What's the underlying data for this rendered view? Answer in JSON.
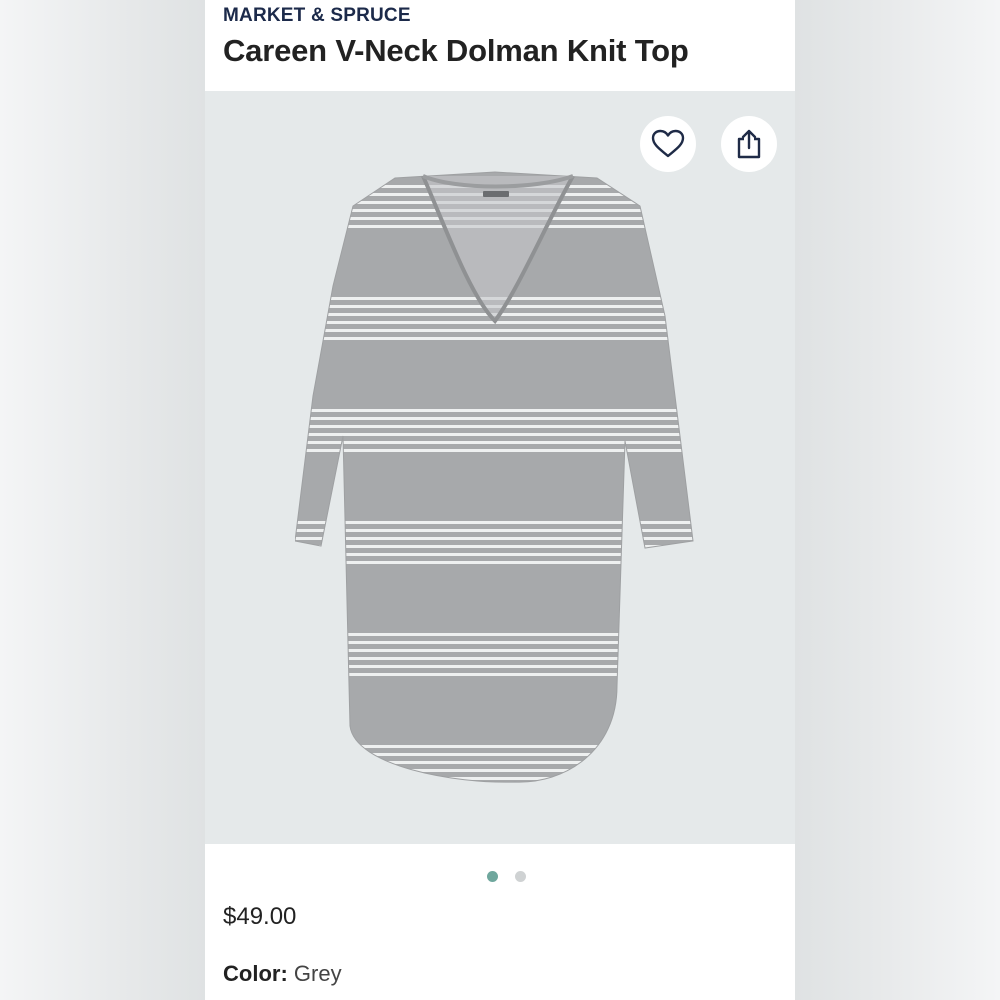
{
  "product": {
    "brand": "MARKET & SPRUCE",
    "title": "Careen V-Neck Dolman Knit Top",
    "price": "$49.00",
    "color_label": "Color:",
    "color_value": "Grey"
  },
  "gallery": {
    "image_count": 2,
    "active_index": 0
  },
  "icons": {
    "favorite": "heart-icon",
    "share": "share-icon"
  },
  "colors": {
    "brand_text": "#1c2a4a",
    "active_dot": "#6fa79d",
    "inactive_dot": "#cfd2d3",
    "image_background": "#e5e9ea"
  }
}
